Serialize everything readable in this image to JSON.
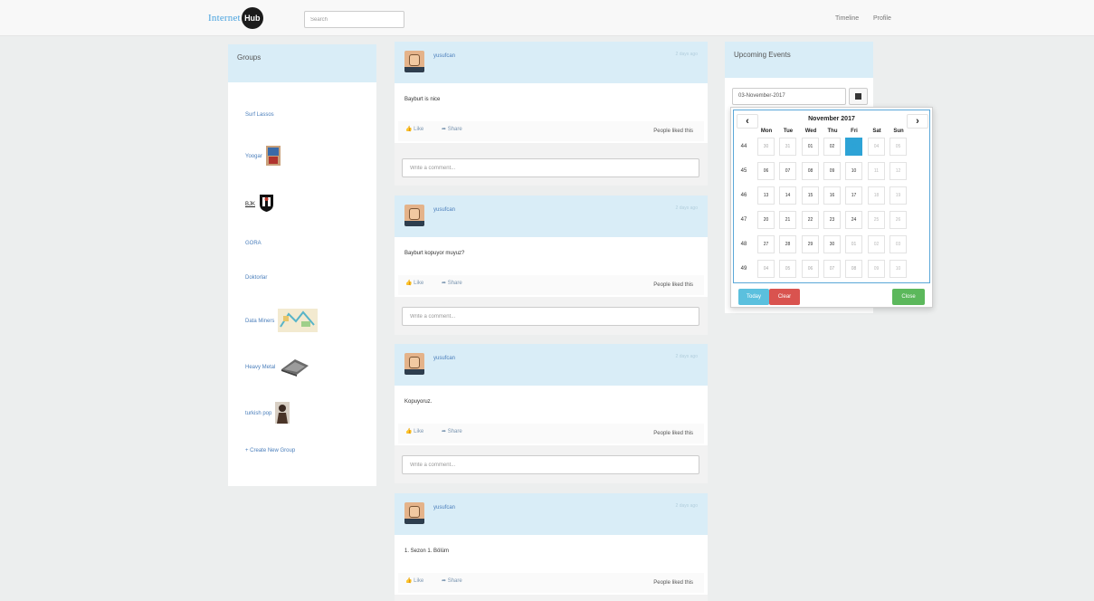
{
  "nav": {
    "brand_text": "Internet",
    "brand_logo": "Hub",
    "search_placeholder": "Search",
    "links": [
      "Timeline",
      "Profile"
    ]
  },
  "groups": {
    "title": "Groups",
    "items": [
      {
        "label": "Surf Lassos",
        "icon": null
      },
      {
        "label": "Yoogar",
        "icon": "group-photo-icon"
      },
      {
        "label": "BJK",
        "icon": "bjk-crest-icon"
      },
      {
        "label": "GORA",
        "icon": null
      },
      {
        "label": "Doktorlar",
        "icon": null
      },
      {
        "label": "Data Miners",
        "icon": "data-map-icon"
      },
      {
        "label": "Heavy Metal",
        "icon": "metal-object-icon"
      },
      {
        "label": "turkish pop",
        "icon": "singer-photo-icon"
      }
    ],
    "create_label": "+ Create New Group"
  },
  "posts": [
    {
      "user": "yusufcan",
      "text": "Bayburt is nice",
      "time": "2 days ago"
    },
    {
      "user": "yusufcan",
      "text": "Bayburt kopuyor muyuz?",
      "time": "2 days ago"
    },
    {
      "user": "yusufcan",
      "text": "Kopuyoruz.",
      "time": "2 days ago"
    },
    {
      "user": "yusufcan",
      "text": "1. Sezon 1. Bölüm",
      "time": "2 days ago"
    }
  ],
  "post_ui": {
    "like": "Like",
    "share": "Share",
    "liked": "People liked this",
    "comment_placeholder": "Write a comment..."
  },
  "events": {
    "title": "Upcoming Events",
    "date_value": "03-November-2017"
  },
  "calendar": {
    "prev": "‹",
    "next": "›",
    "month_label": "November 2017",
    "days_of_week": [
      "Mon",
      "Tue",
      "Wed",
      "Thu",
      "Fri",
      "Sat",
      "Sun"
    ],
    "weeks": [
      {
        "wk": "44",
        "days": [
          "30",
          "31",
          "01",
          "02",
          "03",
          "04",
          "05"
        ]
      },
      {
        "wk": "45",
        "days": [
          "06",
          "07",
          "08",
          "09",
          "10",
          "11",
          "12"
        ]
      },
      {
        "wk": "46",
        "days": [
          "13",
          "14",
          "15",
          "16",
          "17",
          "18",
          "19"
        ]
      },
      {
        "wk": "47",
        "days": [
          "20",
          "21",
          "22",
          "23",
          "24",
          "25",
          "26"
        ]
      },
      {
        "wk": "48",
        "days": [
          "27",
          "28",
          "29",
          "30",
          "01",
          "02",
          "03"
        ]
      },
      {
        "wk": "49",
        "days": [
          "04",
          "05",
          "06",
          "07",
          "08",
          "09",
          "10"
        ]
      }
    ],
    "buttons": {
      "today": "Today",
      "clear": "Clear",
      "close": "Close"
    },
    "colors": {
      "selected": "#2da3d6",
      "today_btn": "#5bc0de",
      "clear_btn": "#d9534f",
      "close_btn": "#5cb85c"
    }
  }
}
